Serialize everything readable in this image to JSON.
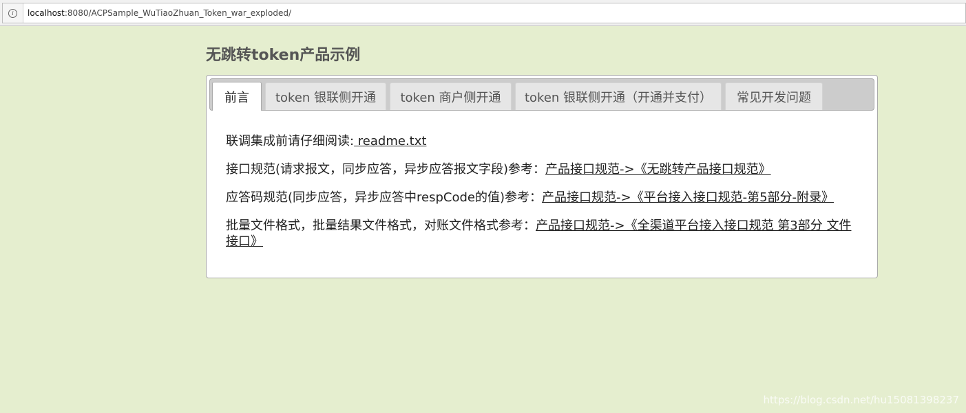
{
  "browser": {
    "url_host": "localhost",
    "url_rest": ":8080/ACPSample_WuTiaoZhuan_Token_war_exploded/",
    "info_icon": "info-icon"
  },
  "page": {
    "title": "无跳转token产品示例"
  },
  "tabs": [
    {
      "label": "前言",
      "active": true
    },
    {
      "label": "token 银联侧开通",
      "active": false
    },
    {
      "label": "token 商户侧开通",
      "active": false
    },
    {
      "label": "token 银联侧开通（开通并支付）",
      "active": false
    },
    {
      "label": "常见开发问题",
      "active": false
    }
  ],
  "content": {
    "line1": {
      "prefix": "联调集成前请仔细阅读:",
      "link": " readme.txt"
    },
    "line2": {
      "prefix": "接口规范(请求报文，同步应答，异步应答报文字段)参考：",
      "link": "产品接口规范->《无跳转产品接口规范》"
    },
    "line3": {
      "prefix": "应答码规范(同步应答，异步应答中respCode的值)参考：",
      "link": "产品接口规范->《平台接入接口规范-第5部分-附录》"
    },
    "line4": {
      "prefix": "批量文件格式，批量结果文件格式，对账文件格式参考：",
      "link": "产品接口规范->《全渠道平台接入接口规范 第3部分 文件接口》"
    }
  },
  "watermark": "https://blog.csdn.net/hu15081398237",
  "colors": {
    "background": "#e5eecf",
    "tab_bar": "#cccccc",
    "panel": "#ffffff"
  }
}
